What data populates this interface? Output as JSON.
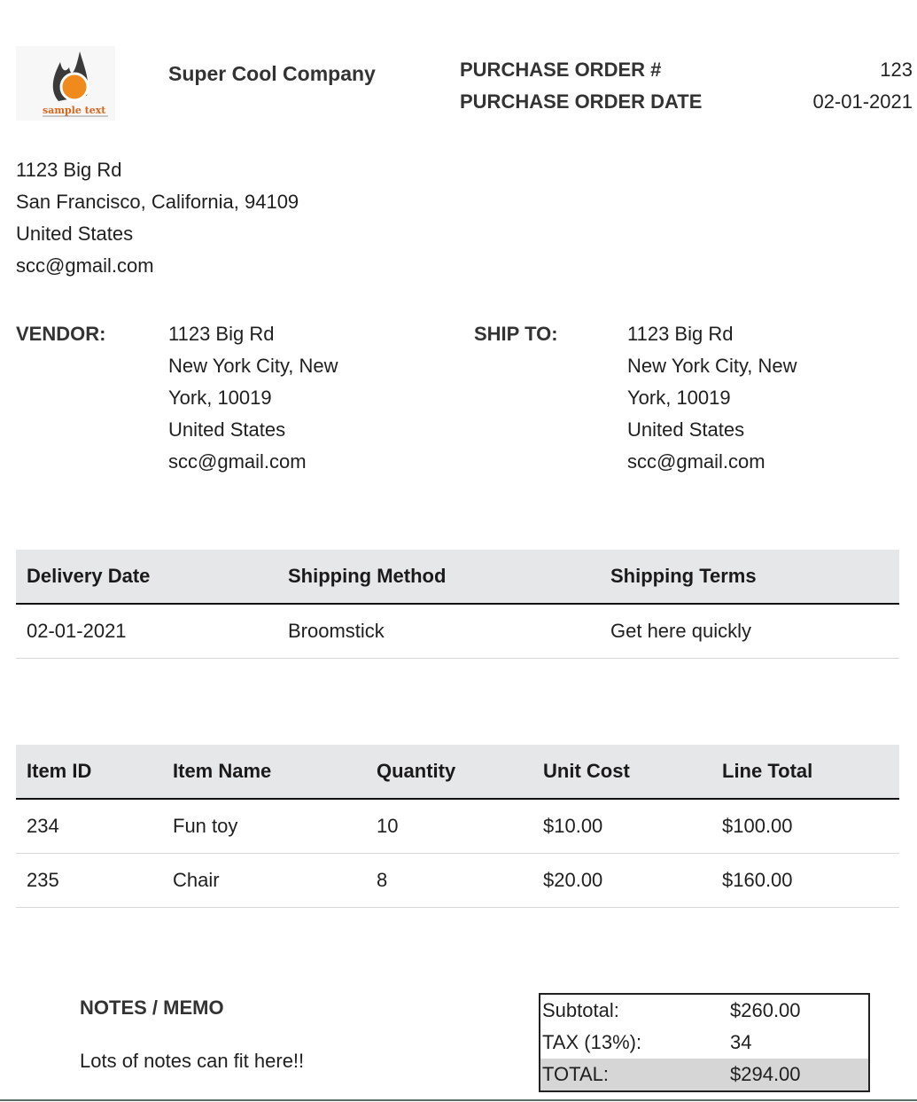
{
  "logo": {
    "text": "sample text",
    "icon": "flame-logo-icon",
    "colors": {
      "flame": "#3a3a3a",
      "circle": "#f08a1c",
      "text": "#d9661c"
    }
  },
  "company": {
    "name": "Super Cool Company"
  },
  "po": {
    "number_label": "PURCHASE ORDER #",
    "number": "123",
    "date_label": "PURCHASE ORDER DATE",
    "date": "02-01-2021"
  },
  "company_address": {
    "line1": "1123 Big Rd",
    "line2": "San Francisco, California, 94109",
    "line3": "United States",
    "email": "scc@gmail.com"
  },
  "vendor": {
    "label": "VENDOR:",
    "line1": "1123 Big Rd",
    "line2": "New York City, New",
    "line3": "York, 10019",
    "line4": "United States",
    "email": "scc@gmail.com"
  },
  "ship_to": {
    "label": "SHIP TO:",
    "line1": "1123 Big Rd",
    "line2": "New York City, New",
    "line3": "York, 10019",
    "line4": "United States",
    "email": "scc@gmail.com"
  },
  "shipping": {
    "headers": [
      "Delivery Date",
      "Shipping Method",
      "Shipping Terms"
    ],
    "row": [
      "02-01-2021",
      "Broomstick",
      "Get here quickly"
    ]
  },
  "items": {
    "headers": [
      "Item ID",
      "Item Name",
      "Quantity",
      "Unit Cost",
      "Line Total"
    ],
    "rows": [
      [
        "234",
        "Fun toy",
        "10",
        "$10.00",
        "$100.00"
      ],
      [
        "235",
        "Chair",
        "8",
        "$20.00",
        "$160.00"
      ]
    ]
  },
  "notes": {
    "title": "NOTES / MEMO",
    "text": "Lots of notes can fit here!!"
  },
  "totals": {
    "subtotal_label": "Subtotal:",
    "subtotal": "$260.00",
    "tax_label": "TAX (13%):",
    "tax": "34",
    "total_label": "TOTAL:",
    "total": "$294.00"
  }
}
